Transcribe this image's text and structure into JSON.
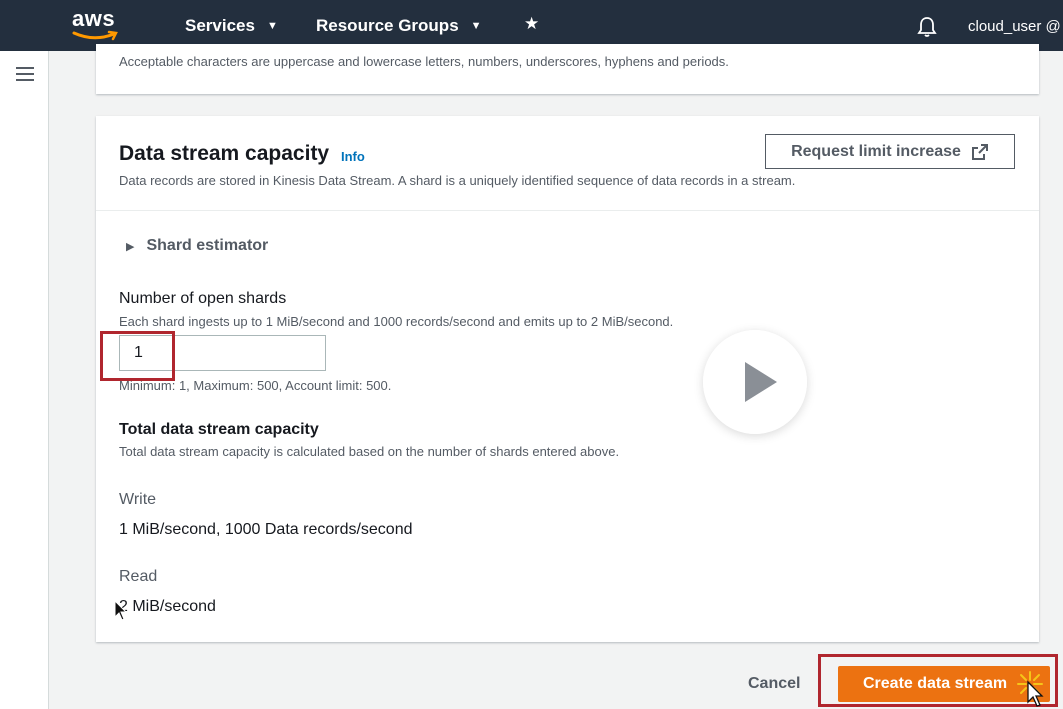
{
  "nav": {
    "logo_text": "aws",
    "services_label": "Services",
    "resource_groups_label": "Resource Groups",
    "user_label": "cloud_user @"
  },
  "top_panel": {
    "hint": "Acceptable characters are uppercase and lowercase letters, numbers, underscores, hyphens and periods."
  },
  "capacity": {
    "title": "Data stream capacity",
    "info_label": "Info",
    "description": "Data records are stored in Kinesis Data Stream. A shard is a uniquely identified sequence of data records in a stream.",
    "request_limit_label": "Request limit increase",
    "estimator_label": "Shard estimator",
    "open_shards_label": "Number of open shards",
    "open_shards_hint": "Each shard ingests up to 1 MiB/second and 1000 records/second and emits up to 2 MiB/second.",
    "open_shards_value": "1",
    "open_shards_constraint": "Minimum: 1, Maximum: 500, Account limit: 500.",
    "total_label": "Total data stream capacity",
    "total_hint": "Total data stream capacity is calculated based on the number of shards entered above.",
    "write_label": "Write",
    "write_value": "1 MiB/second, 1000 Data records/second",
    "read_label": "Read",
    "read_value": "2 MiB/second"
  },
  "actions": {
    "cancel_label": "Cancel",
    "create_label": "Create data stream"
  },
  "colors": {
    "nav_bg": "#232f3e",
    "primary": "#ec7211",
    "link": "#0073bb",
    "highlight": "#b0262e"
  }
}
